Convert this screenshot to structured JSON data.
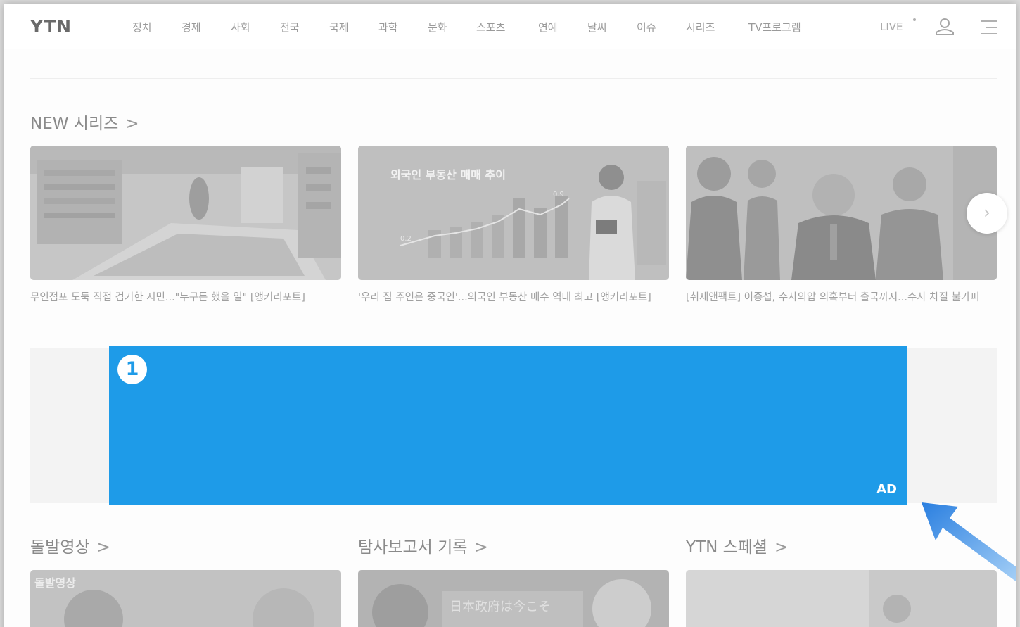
{
  "header": {
    "logo": "YTN",
    "nav": [
      "정치",
      "경제",
      "사회",
      "전국",
      "국제",
      "과학",
      "문화",
      "스포츠",
      "연예",
      "날씨",
      "이슈",
      "시리즈",
      "TV프로그램"
    ],
    "live_label": "LIVE"
  },
  "new_series": {
    "title": "NEW 시리즈",
    "chevron": ">",
    "cards": [
      {
        "caption": "무인점포 도둑 직접 검거한 시민...\"누구든 했을 일\" [앵커리포트]"
      },
      {
        "caption": "'우리 집 주인은 중국인'...외국인 부동산 매수 역대 최고 [앵커리포트]",
        "thumb_title": "외국인 부동산 매매 추이",
        "thumb_values": [
          "0.2",
          "0.9"
        ]
      },
      {
        "caption": "[취재앤팩트] 이종섭, 수사외압 의혹부터 출국까지...수사 차질 불가피"
      }
    ],
    "next_label": "›"
  },
  "ad": {
    "badge": "1",
    "label": "AD",
    "color": "#1e9be8"
  },
  "sections_bottom": [
    {
      "title": "돌발영상",
      "thumb_text": "돌발영상"
    },
    {
      "title": "탐사보고서 기록",
      "thumb_text": "日本政府は今こそ"
    },
    {
      "title": "YTN 스페셜"
    }
  ]
}
